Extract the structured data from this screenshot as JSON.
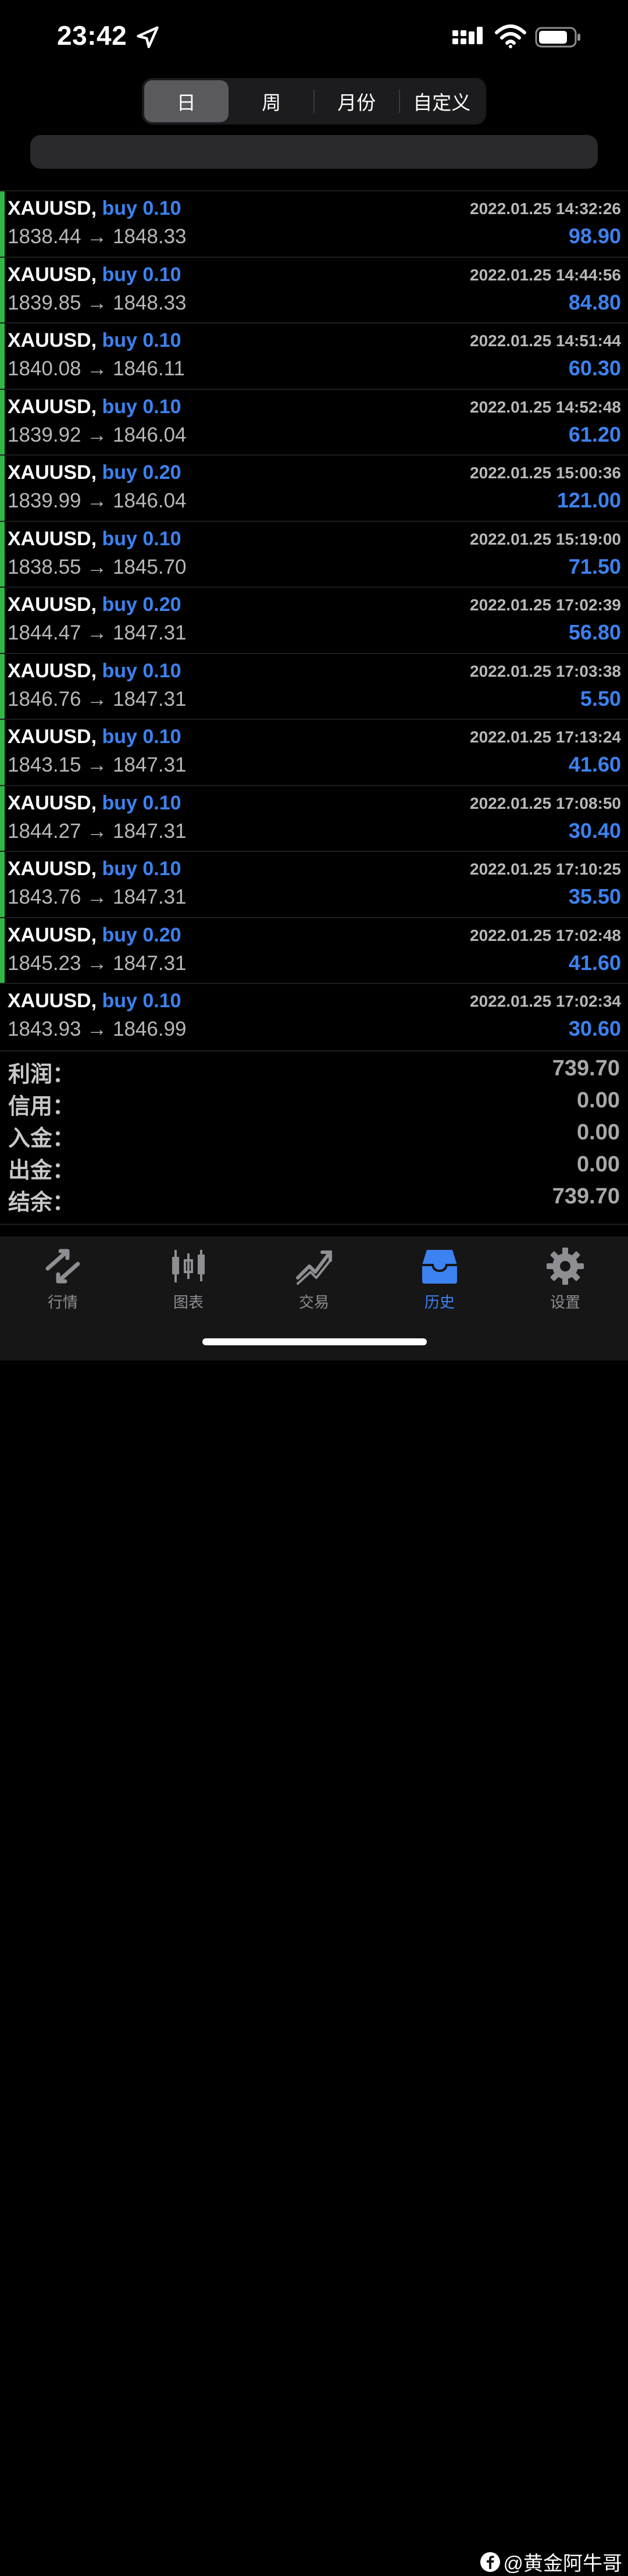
{
  "status": {
    "time": "23:42"
  },
  "tabs_segment": [
    {
      "label": "日",
      "active": true
    },
    {
      "label": "周",
      "active": false
    },
    {
      "label": "月份",
      "active": false
    },
    {
      "label": "自定义",
      "active": false
    }
  ],
  "trades": [
    {
      "symbol": "XAUUSD,",
      "side": "buy 0.10",
      "open": "1838.44",
      "close": "1848.33",
      "time": "2022.01.25 14:32:26",
      "profit": "98.90",
      "marked": true
    },
    {
      "symbol": "XAUUSD,",
      "side": "buy 0.10",
      "open": "1839.85",
      "close": "1848.33",
      "time": "2022.01.25 14:44:56",
      "profit": "84.80",
      "marked": true
    },
    {
      "symbol": "XAUUSD,",
      "side": "buy 0.10",
      "open": "1840.08",
      "close": "1846.11",
      "time": "2022.01.25 14:51:44",
      "profit": "60.30",
      "marked": true
    },
    {
      "symbol": "XAUUSD,",
      "side": "buy 0.10",
      "open": "1839.92",
      "close": "1846.04",
      "time": "2022.01.25 14:52:48",
      "profit": "61.20",
      "marked": true
    },
    {
      "symbol": "XAUUSD,",
      "side": "buy 0.20",
      "open": "1839.99",
      "close": "1846.04",
      "time": "2022.01.25 15:00:36",
      "profit": "121.00",
      "marked": true
    },
    {
      "symbol": "XAUUSD,",
      "side": "buy 0.10",
      "open": "1838.55",
      "close": "1845.70",
      "time": "2022.01.25 15:19:00",
      "profit": "71.50",
      "marked": true
    },
    {
      "symbol": "XAUUSD,",
      "side": "buy 0.20",
      "open": "1844.47",
      "close": "1847.31",
      "time": "2022.01.25 17:02:39",
      "profit": "56.80",
      "marked": true
    },
    {
      "symbol": "XAUUSD,",
      "side": "buy 0.10",
      "open": "1846.76",
      "close": "1847.31",
      "time": "2022.01.25 17:03:38",
      "profit": "5.50",
      "marked": true
    },
    {
      "symbol": "XAUUSD,",
      "side": "buy 0.10",
      "open": "1843.15",
      "close": "1847.31",
      "time": "2022.01.25 17:13:24",
      "profit": "41.60",
      "marked": true
    },
    {
      "symbol": "XAUUSD,",
      "side": "buy 0.10",
      "open": "1844.27",
      "close": "1847.31",
      "time": "2022.01.25 17:08:50",
      "profit": "30.40",
      "marked": true
    },
    {
      "symbol": "XAUUSD,",
      "side": "buy 0.10",
      "open": "1843.76",
      "close": "1847.31",
      "time": "2022.01.25 17:10:25",
      "profit": "35.50",
      "marked": true
    },
    {
      "symbol": "XAUUSD,",
      "side": "buy 0.20",
      "open": "1845.23",
      "close": "1847.31",
      "time": "2022.01.25 17:02:48",
      "profit": "41.60",
      "marked": true
    },
    {
      "symbol": "XAUUSD,",
      "side": "buy 0.10",
      "open": "1843.93",
      "close": "1846.99",
      "time": "2022.01.25 17:02:34",
      "profit": "30.60",
      "marked": false
    }
  ],
  "summary": [
    {
      "label": "利润：",
      "value": "739.70"
    },
    {
      "label": "信用：",
      "value": "0.00"
    },
    {
      "label": "入金：",
      "value": "0.00"
    },
    {
      "label": "出金：",
      "value": "0.00"
    },
    {
      "label": "结余：",
      "value": "739.70"
    }
  ],
  "bottom_tabs": [
    {
      "label": "行情",
      "icon": "quotes-icon",
      "active": false
    },
    {
      "label": "图表",
      "icon": "chart-icon",
      "active": false
    },
    {
      "label": "交易",
      "icon": "trade-icon",
      "active": false
    },
    {
      "label": "历史",
      "icon": "history-icon",
      "active": true
    },
    {
      "label": "设置",
      "icon": "gear-icon",
      "active": false
    }
  ],
  "watermark": "@黄金阿牛哥",
  "colors": {
    "accent_blue": "#3c82f0",
    "marker_green": "#2fb844",
    "background": "#000000"
  }
}
